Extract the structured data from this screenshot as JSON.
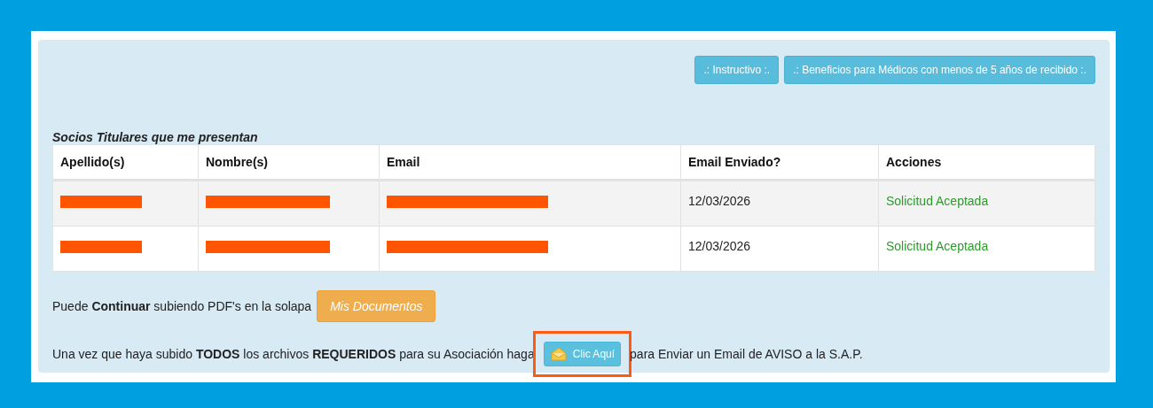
{
  "top_buttons": [
    {
      "label": ".: Instructivo :."
    },
    {
      "label": ".: Beneficios para Médicos con menos de 5 años de recibido :."
    }
  ],
  "table": {
    "caption": "Socios Titulares que me presentan",
    "columns": [
      "Apellido(s)",
      "Nombre(s)",
      "Email",
      "Email Enviado?",
      "Acciones"
    ],
    "rows": [
      {
        "cells": [
          {
            "kind": "redacted"
          },
          {
            "kind": "redacted"
          },
          {
            "kind": "redacted"
          },
          {
            "kind": "text",
            "text": "12/03/2026"
          },
          {
            "kind": "status",
            "text": "Solicitud Aceptada"
          }
        ]
      },
      {
        "cells": [
          {
            "kind": "redacted"
          },
          {
            "kind": "redacted"
          },
          {
            "kind": "redacted"
          },
          {
            "kind": "text",
            "text": "12/03/2026"
          },
          {
            "kind": "status",
            "text": "Solicitud Aceptada"
          }
        ]
      }
    ]
  },
  "continue_line": {
    "text": "Puede **Continuar** subiendo PDF's en la solapa",
    "button": "Mis Documentos"
  },
  "notify_line": {
    "before": "Una vez que haya subido **TODOS** los archivos **REQUERIDOS** para su Asociación haga",
    "button": "Clic Aquí",
    "highlighted": true,
    "after": "para Enviar un Email de AVISO a la S.A.P."
  }
}
